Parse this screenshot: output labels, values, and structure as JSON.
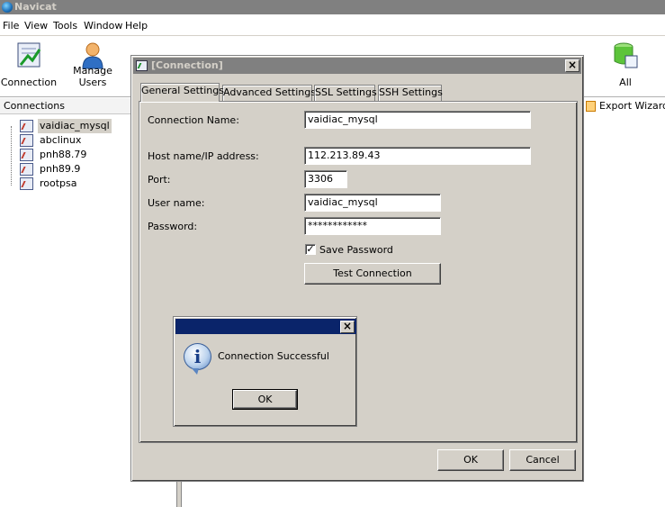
{
  "app": {
    "title": "Navicat"
  },
  "menu": [
    "File",
    "View",
    "Tools",
    "Window",
    "Help"
  ],
  "toolbar": {
    "connection_label": "Connection",
    "manage_users_label": "Manage Users",
    "all_label": "All"
  },
  "connections_panel": {
    "header": "Connections",
    "items": [
      "vaidiac_mysql",
      "abclinux",
      "pnh88.79",
      "pnh89.9",
      "rootpsa"
    ],
    "selected": "vaidiac_mysql"
  },
  "export_wizard_label": "Export Wizard",
  "dialog": {
    "title": "[Connection]",
    "close": "×",
    "tabs": [
      "General Settings",
      "Advanced Settings",
      "SSL Settings",
      "SSH Settings"
    ],
    "active_tab": "General Settings",
    "fields": {
      "connection_name_label": "Connection Name:",
      "connection_name": "vaidiac_mysql",
      "host_label": "Host name/IP address:",
      "host": "112.213.89.43",
      "port_label": "Port:",
      "port": "3306",
      "user_label": "User name:",
      "user": "vaidiac_mysql",
      "password_label": "Password:",
      "password": "************"
    },
    "save_password_label": "Save Password",
    "save_password_checked": "✓",
    "test_connection_label": "Test Connection",
    "ok_label": "OK",
    "cancel_label": "Cancel"
  },
  "message_box": {
    "close": "×",
    "icon": "i",
    "message": "Connection Successful",
    "ok_label": "OK"
  },
  "colors": {
    "dialog_face": "#d4d0c8",
    "inactive_title": "#808080",
    "active_title": "#0a246a"
  }
}
